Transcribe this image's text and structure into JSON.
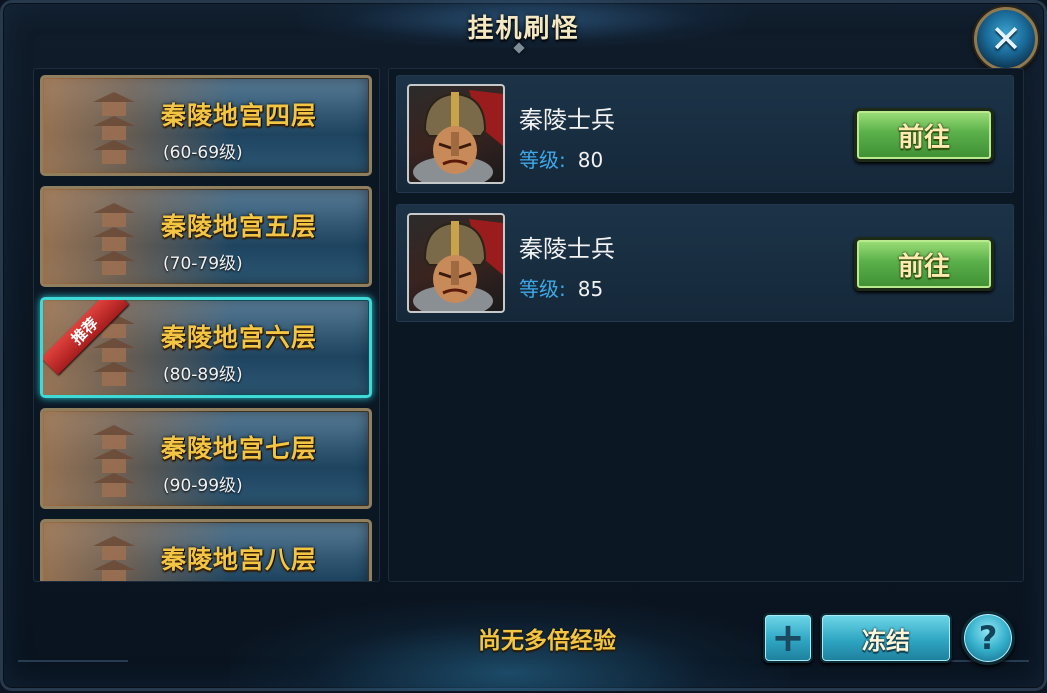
{
  "window": {
    "title": "挂机刷怪",
    "close_label": "✕"
  },
  "floors": [
    {
      "name": "秦陵地宫四层",
      "range": "(60-69级)",
      "selected": false,
      "badge": ""
    },
    {
      "name": "秦陵地宫五层",
      "range": "(70-79级)",
      "selected": false,
      "badge": ""
    },
    {
      "name": "秦陵地宫六层",
      "range": "(80-89级)",
      "selected": true,
      "badge": "推荐"
    },
    {
      "name": "秦陵地宫七层",
      "range": "(90-99级)",
      "selected": false,
      "badge": ""
    },
    {
      "name": "秦陵地宫八层",
      "range": "",
      "selected": false,
      "badge": ""
    }
  ],
  "monsters": [
    {
      "name": "秦陵士兵",
      "level_label": "等级:",
      "level": "80",
      "go_label": "前往"
    },
    {
      "name": "秦陵士兵",
      "level_label": "等级:",
      "level": "85",
      "go_label": "前往"
    }
  ],
  "footer": {
    "exp_status": "尚无多倍经验",
    "plus_label": "+",
    "freeze_label": "冻结",
    "help_label": "?"
  },
  "colors": {
    "floor_title": "#f2c544",
    "selected_border": "#3fd9d8",
    "level_label": "#3fa9e8",
    "go_button": "#5ab04a",
    "freeze_button": "#2ea6c3",
    "badge": "#d03030"
  }
}
